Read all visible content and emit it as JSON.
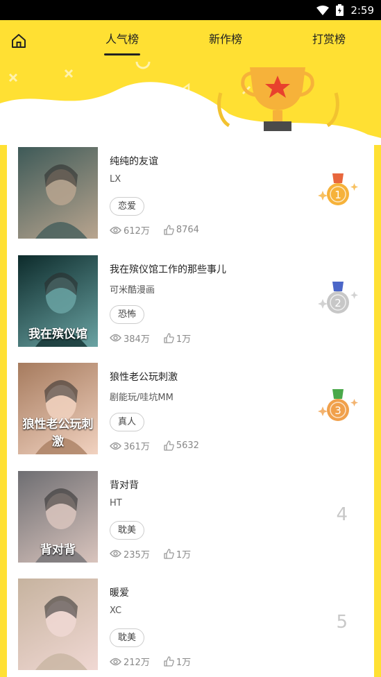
{
  "status_bar": {
    "time": "2:59"
  },
  "tabs": [
    {
      "label": "人气榜",
      "active": true
    },
    {
      "label": "新作榜",
      "active": false
    },
    {
      "label": "打赏榜",
      "active": false
    }
  ],
  "colors": {
    "background": "#ffe033",
    "gold": "#f2b705",
    "gold_medal": "#f6b23a",
    "silver_medal": "#c7c7c7",
    "bronze_medal": "#f0a04b"
  },
  "comics": [
    {
      "rank": "1",
      "title": "纯纯的友谊",
      "author": "LX",
      "tag": "恋爱",
      "views": "612万",
      "likes": "8764",
      "cover_text": "",
      "medal": "gold"
    },
    {
      "rank": "2",
      "title": "我在殡仪馆工作的那些事儿",
      "author": "可米酷漫画",
      "tag": "恐怖",
      "views": "384万",
      "likes": "1万",
      "cover_text": "我在殡仪馆",
      "medal": "silver"
    },
    {
      "rank": "3",
      "title": "狼性老公玩刺激",
      "author": "剧能玩/哇坑MM",
      "tag": "真人",
      "views": "361万",
      "likes": "5632",
      "cover_text": "狼性老公玩刺激",
      "medal": "bronze"
    },
    {
      "rank": "4",
      "title": "背对背",
      "author": "HT",
      "tag": "耽美",
      "views": "235万",
      "likes": "1万",
      "cover_text": "背对背",
      "medal": "none"
    },
    {
      "rank": "5",
      "title": "暖爱",
      "author": "XC",
      "tag": "耽美",
      "views": "212万",
      "likes": "1万",
      "cover_text": "",
      "medal": "none"
    }
  ]
}
